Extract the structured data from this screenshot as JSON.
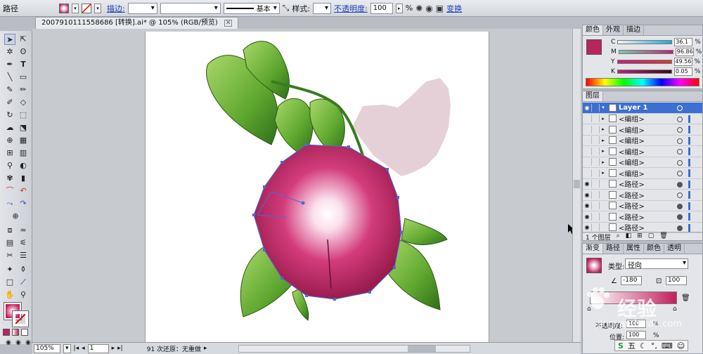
{
  "control_bar": {
    "object_type": "路径",
    "stroke_label": "描边:",
    "stroke_style": "基本",
    "style_label": "样式:",
    "opacity_label": "不透明度:",
    "opacity_value": "100",
    "opacity_unit": "%",
    "transform_link": "变换"
  },
  "document_tab": {
    "title": "2007910111558686 [转换].ai* @ 105% (RGB/预览)"
  },
  "color_panel": {
    "tabs": [
      "颜色",
      "外观",
      "描边"
    ],
    "channels": [
      {
        "label": "C",
        "value": "36.1",
        "color": "#3aa6d0"
      },
      {
        "label": "M",
        "value": "96.86",
        "color": "#c0207a"
      },
      {
        "label": "Y",
        "value": "49.56",
        "color": "#d4c61a"
      },
      {
        "label": "K",
        "value": "0.05",
        "color": "#222222"
      }
    ],
    "fill_color": "#b8245c"
  },
  "layers_panel": {
    "title": "图层",
    "rows": [
      {
        "name": "Layer 1",
        "selected": true
      },
      {
        "name": "<编组>"
      },
      {
        "name": "<编组>"
      },
      {
        "name": "<编组>"
      },
      {
        "name": "<编组>"
      },
      {
        "name": "<编组>"
      },
      {
        "name": "<编组>"
      },
      {
        "name": "<路径>"
      },
      {
        "name": "<路径>"
      },
      {
        "name": "<路径>"
      },
      {
        "name": "<路径>"
      },
      {
        "name": "<路径>"
      }
    ],
    "footer": "1 个图层"
  },
  "gradient_panel": {
    "tabs": [
      "渐变",
      "路径",
      "属性",
      "颜色",
      "透明"
    ],
    "type_label": "类型:",
    "type_value": "径向",
    "angle_value": "-180",
    "ratio_value": "100",
    "opacity_label": "不透明度:",
    "opacity_value": "100",
    "location_label": "位置:",
    "location_value": "100",
    "unit": "%"
  },
  "status_bar": {
    "zoom": "105%",
    "page": "1",
    "undo_text": "91 次还原：无重做"
  },
  "watermark": {
    "text": "经验",
    "url": "jingyan.baidu.com"
  },
  "ime": {
    "label": "五"
  }
}
